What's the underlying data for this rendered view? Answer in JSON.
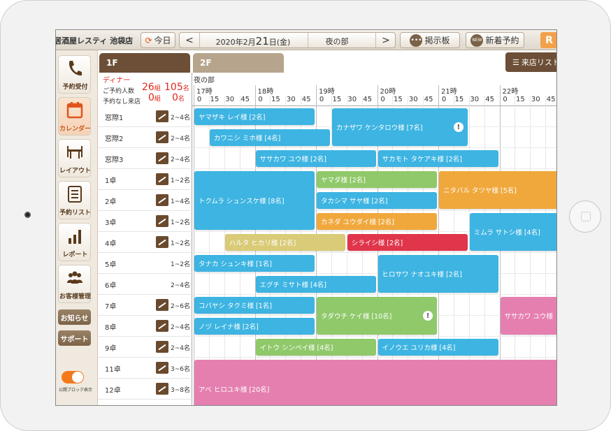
{
  "header": {
    "store_name": "居酒屋レスティ 池袋店",
    "today_label": "今日",
    "prev": "<",
    "next": ">",
    "date_year_month": "2020年2月",
    "date_day": "21",
    "date_suffix": "日(金)",
    "session": "夜の部",
    "board_label": "掲示板",
    "new_badge": "NEW",
    "new_reservation_label": "新着予約",
    "logo_text": "R"
  },
  "sidenav": {
    "items": [
      {
        "label": "予約受付",
        "icon": "phone-icon"
      },
      {
        "label": "カレンダー",
        "icon": "calendar-icon"
      },
      {
        "label": "レイアウト",
        "icon": "table-layout-icon"
      },
      {
        "label": "予約リスト",
        "icon": "list-icon"
      },
      {
        "label": "レポート",
        "icon": "bar-chart-icon"
      },
      {
        "label": "お客様管理",
        "icon": "customers-icon"
      }
    ],
    "notice_label": "お知らせ",
    "support_label": "サポート",
    "toggle_label": "公開ブロック表示"
  },
  "tabs": {
    "floor1": "1F",
    "floor2": "2F",
    "visit_list": "来店リスト"
  },
  "summary": {
    "dinner_label": "ディナー",
    "reserved_label": "ご予約人数",
    "reserved_groups": "26",
    "reserved_people": "105",
    "walkin_label": "予約なし来店",
    "walkin_groups": "0",
    "walkin_people": "0",
    "groups_unit": "組",
    "people_unit": "名"
  },
  "timeline": {
    "session_label": "夜の部",
    "hours": [
      "17時",
      "18時",
      "19時",
      "20時",
      "21時",
      "22時"
    ],
    "quarters": [
      "0",
      "15",
      "30",
      "45"
    ]
  },
  "tables": [
    {
      "name": "窓際1",
      "capacity": "2~4名",
      "smoking": true
    },
    {
      "name": "窓際2",
      "capacity": "2~4名",
      "smoking": true
    },
    {
      "name": "窓際3",
      "capacity": "2~4名",
      "smoking": true
    },
    {
      "name": "1卓",
      "capacity": "1~2名",
      "smoking": true
    },
    {
      "name": "2卓",
      "capacity": "1~4名",
      "smoking": true
    },
    {
      "name": "3卓",
      "capacity": "1~2名",
      "smoking": true
    },
    {
      "name": "4卓",
      "capacity": "1~2名",
      "smoking": true
    },
    {
      "name": "5卓",
      "capacity": "1~2名",
      "smoking": false
    },
    {
      "name": "6卓",
      "capacity": "2~4名",
      "smoking": false
    },
    {
      "name": "7卓",
      "capacity": "2~6名",
      "smoking": true
    },
    {
      "name": "8卓",
      "capacity": "2~4名",
      "smoking": true
    },
    {
      "name": "9卓",
      "capacity": "2~4名",
      "smoking": true
    },
    {
      "name": "11卓",
      "capacity": "3~6名",
      "smoking": true
    },
    {
      "name": "12卓",
      "capacity": "3~8名",
      "smoking": true
    }
  ],
  "reservations": [
    {
      "label": "ヤマザキ レイ様 [2名]",
      "row": 0,
      "rows": 1,
      "start": "17:00",
      "end": "19:00",
      "color": "#3db4e2",
      "alert": false
    },
    {
      "label": "カナザワ ケンタロウ様 [7名]",
      "row": 0,
      "rows": 2,
      "start": "19:15",
      "end": "21:30",
      "color": "#3db4e2",
      "alert": true
    },
    {
      "label": "カワニシ ミホ様 [4名]",
      "row": 1,
      "rows": 1,
      "start": "17:15",
      "end": "19:15",
      "color": "#3db4e2",
      "alert": false
    },
    {
      "label": "ササカワ ユウ様 [2名]",
      "row": 2,
      "rows": 1,
      "start": "18:00",
      "end": "20:00",
      "color": "#3db4e2",
      "alert": false
    },
    {
      "label": "サカモト タケアキ様 [2名]",
      "row": 2,
      "rows": 1,
      "start": "20:00",
      "end": "22:00",
      "color": "#3db4e2",
      "alert": false
    },
    {
      "label": "トクムラ シュンスケ様 [8名]",
      "row": 3,
      "rows": 3,
      "start": "17:00",
      "end": "19:00",
      "color": "#3db4e2",
      "alert": false
    },
    {
      "label": "ヤマダ様 [2名]",
      "row": 3,
      "rows": 1,
      "start": "19:00",
      "end": "21:00",
      "color": "#8fc96a",
      "alert": false
    },
    {
      "label": "ニタバル タツヤ様 [5名]",
      "row": 3,
      "rows": 2,
      "start": "21:00",
      "end": "23:00",
      "color": "#f0a83d",
      "alert": false
    },
    {
      "label": "タカシマ サヤ様 [2名]",
      "row": 4,
      "rows": 1,
      "start": "19:00",
      "end": "21:00",
      "color": "#3db4e2",
      "alert": false
    },
    {
      "label": "カネダ ユウダイ様 [2名]",
      "row": 5,
      "rows": 1,
      "start": "19:00",
      "end": "21:00",
      "color": "#f0a83d",
      "alert": false
    },
    {
      "label": "ミムラ サトシ様 [4名]",
      "row": 5,
      "rows": 2,
      "start": "21:30",
      "end": "23:30",
      "color": "#3db4e2",
      "alert": false
    },
    {
      "label": "ハルタ ヒカリ様 [2名]",
      "row": 6,
      "rows": 1,
      "start": "17:30",
      "end": "19:30",
      "color": "#d9cb77",
      "alert": false
    },
    {
      "label": "シライシ様 [2名]",
      "row": 6,
      "rows": 1,
      "start": "19:30",
      "end": "21:30",
      "color": "#e0354a",
      "alert": false
    },
    {
      "label": "タナカ シュンキ様 [1名]",
      "row": 7,
      "rows": 1,
      "start": "17:00",
      "end": "19:00",
      "color": "#3db4e2",
      "alert": false
    },
    {
      "label": "ヒロサワ ナオユキ様 [2名]",
      "row": 7,
      "rows": 2,
      "start": "20:00",
      "end": "22:00",
      "color": "#3db4e2",
      "alert": false
    },
    {
      "label": "エグチ ミサト様 [4名]",
      "row": 8,
      "rows": 1,
      "start": "18:00",
      "end": "20:00",
      "color": "#3db4e2",
      "alert": false
    },
    {
      "label": "コバヤシ タクミ様 [1名]",
      "row": 9,
      "rows": 1,
      "start": "17:00",
      "end": "19:00",
      "color": "#3db4e2",
      "alert": false
    },
    {
      "label": "タダウチ ケイ様 [10名]",
      "row": 9,
      "rows": 2,
      "start": "19:00",
      "end": "21:00",
      "color": "#8fc96a",
      "alert": true
    },
    {
      "label": "ササカワ ユウ様",
      "row": 9,
      "rows": 2,
      "start": "22:00",
      "end": "23:30",
      "color": "#e57fb0",
      "alert": false
    },
    {
      "label": "ノヅ レイナ様 [2名]",
      "row": 10,
      "rows": 1,
      "start": "17:00",
      "end": "19:00",
      "color": "#3db4e2",
      "alert": false
    },
    {
      "label": "イトウ シンペイ様 [4名]",
      "row": 11,
      "rows": 1,
      "start": "18:00",
      "end": "20:00",
      "color": "#8fc96a",
      "alert": false
    },
    {
      "label": "イノウエ ユリカ様 [4名]",
      "row": 11,
      "rows": 1,
      "start": "20:00",
      "end": "22:00",
      "color": "#3db4e2",
      "alert": false
    },
    {
      "label": "アベ ヒロユキ様 [20名]",
      "row": 12,
      "rows": 3,
      "start": "17:00",
      "end": "23:30",
      "color": "#e57fb0",
      "alert": false
    }
  ]
}
